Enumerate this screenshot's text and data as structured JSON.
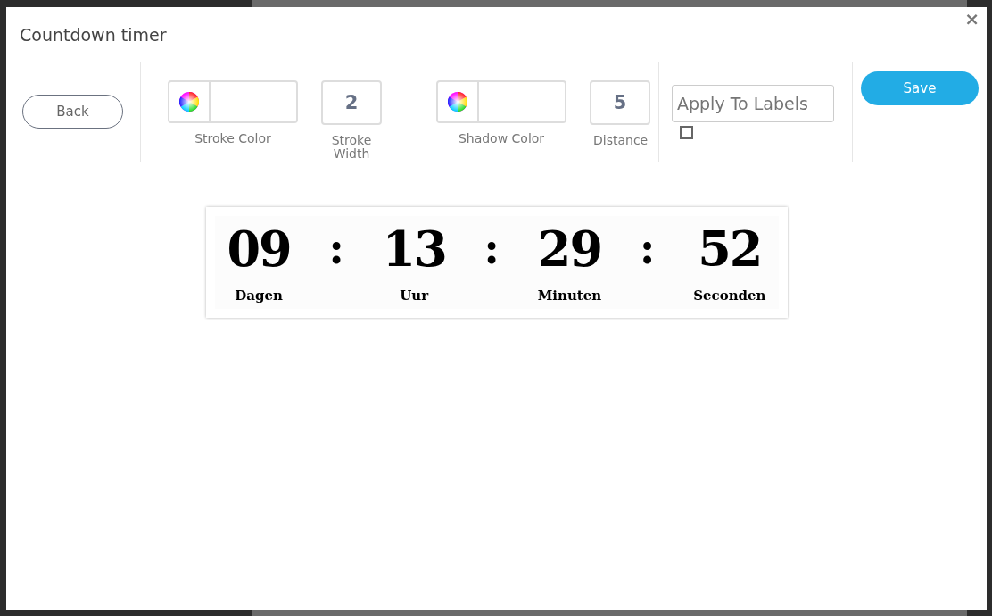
{
  "window": {
    "title": "Countdown timer",
    "close": "×"
  },
  "toolbar": {
    "back": "Back",
    "stroke": {
      "color_label": "Stroke Color",
      "width_value": "2",
      "width_label": "Stroke Width"
    },
    "shadow": {
      "color_label": "Shadow Color",
      "distance_value": "5",
      "distance_label": "Distance"
    },
    "apply": {
      "placeholder": "Apply To Labels",
      "checked": false
    },
    "save": "Save"
  },
  "timer": {
    "units": [
      {
        "value": "09",
        "label": "Dagen"
      },
      {
        "value": "13",
        "label": "Uur"
      },
      {
        "value": "29",
        "label": "Minuten"
      },
      {
        "value": "52",
        "label": "Seconden"
      }
    ],
    "separators": [
      ":",
      ":",
      ":"
    ]
  }
}
